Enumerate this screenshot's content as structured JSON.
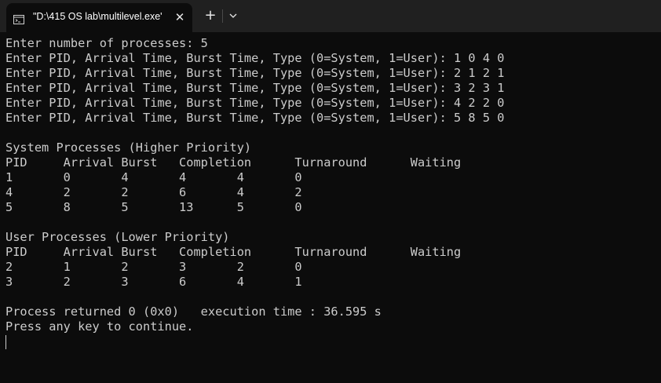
{
  "tab": {
    "title": "\"D:\\415 OS lab\\multilevel.exe'",
    "icon": "terminal-icon",
    "close_glyph": "✕",
    "new_tab_glyph": "+",
    "dropdown_icon": "chevron-down-icon"
  },
  "console": {
    "lines": [
      "Enter number of processes: 5",
      "Enter PID, Arrival Time, Burst Time, Type (0=System, 1=User): 1 0 4 0",
      "Enter PID, Arrival Time, Burst Time, Type (0=System, 1=User): 2 1 2 1",
      "Enter PID, Arrival Time, Burst Time, Type (0=System, 1=User): 3 2 3 1",
      "Enter PID, Arrival Time, Burst Time, Type (0=System, 1=User): 4 2 2 0",
      "Enter PID, Arrival Time, Burst Time, Type (0=System, 1=User): 5 8 5 0",
      "",
      "System Processes (Higher Priority)",
      "PID     Arrival Burst   Completion      Turnaround      Waiting",
      "1       0       4       4       4       0",
      "4       2       2       6       4       2",
      "5       8       5       13      5       0",
      "",
      "User Processes (Lower Priority)",
      "PID     Arrival Burst   Completion      Turnaround      Waiting",
      "2       1       2       3       2       0",
      "3       2       3       6       4       1",
      "",
      "Process returned 0 (0x0)   execution time : 36.595 s",
      "Press any key to continue."
    ]
  },
  "colors": {
    "background": "#0c0c0c",
    "titlebar": "#202020",
    "text": "#cccccc"
  }
}
